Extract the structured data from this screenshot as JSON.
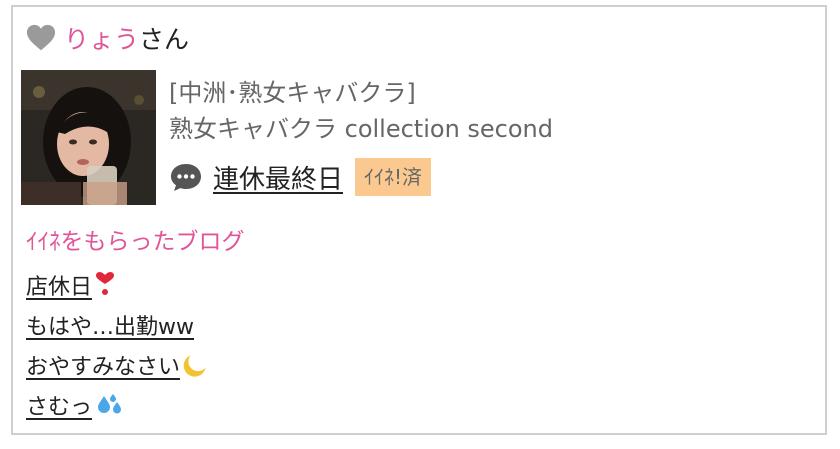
{
  "header": {
    "user_name": "りょう",
    "suffix": "さん",
    "heart_color": "#9a9a9a"
  },
  "profile": {
    "shop_category": "[中洲･熟女キャバクラ]",
    "shop_name": "熟女キャバクラ collection second"
  },
  "post": {
    "title": "連休最終日",
    "badge": "ｲｲﾈ!済",
    "badge_color": "#fbc98f"
  },
  "liked_section": {
    "title": "ｲｲﾈをもらったブログ",
    "blogs": [
      {
        "text": "店休日",
        "icon": "heart-exclamation-icon"
      },
      {
        "text": "もはや…出勤ww",
        "icon": ""
      },
      {
        "text": "おやすみなさい",
        "icon": "crescent-moon-icon"
      },
      {
        "text": "さむっ",
        "icon": "sweat-droplets-icon"
      }
    ]
  },
  "colors": {
    "accent_pink": "#e0559a",
    "border": "#cfcfcf",
    "text_gray": "#666666"
  }
}
